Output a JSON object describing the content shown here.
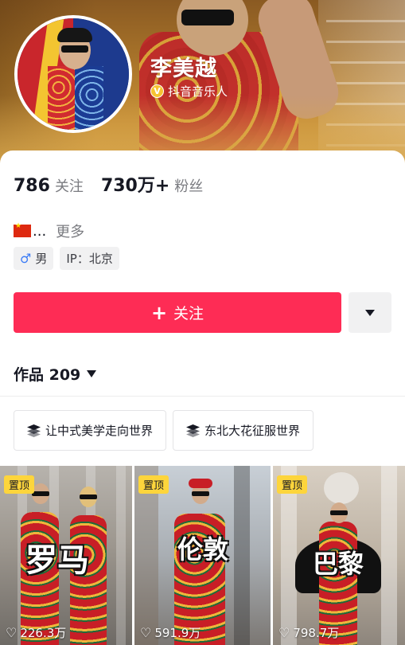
{
  "profile": {
    "name": "李美越",
    "verification_label": "抖音音乐人",
    "verify_badge_icon": "verified-badge-icon"
  },
  "stats": {
    "following_count": "786",
    "following_label": "关注",
    "followers_count": "730万+",
    "followers_label": "粉丝"
  },
  "bio": {
    "flag_icon": "china-flag-icon",
    "truncated": "...",
    "more_label": "更多"
  },
  "tags": {
    "gender_icon": "male-icon",
    "gender": "男",
    "ip_location": "IP：北京"
  },
  "actions": {
    "follow_label": "关注",
    "follow_color": "#fe2c55"
  },
  "works": {
    "label": "作品 209"
  },
  "collections": [
    {
      "label": "让中式美学走向世界"
    },
    {
      "label": "东北大花征服世界"
    }
  ],
  "videos": [
    {
      "pin_label": "置顶",
      "overlay_text": "罗马",
      "plays": "226.3万"
    },
    {
      "pin_label": "置顶",
      "overlay_text": "伦敦",
      "plays": "591.9万"
    },
    {
      "pin_label": "置顶",
      "overlay_text": "巴黎",
      "plays": "798.7万"
    }
  ]
}
